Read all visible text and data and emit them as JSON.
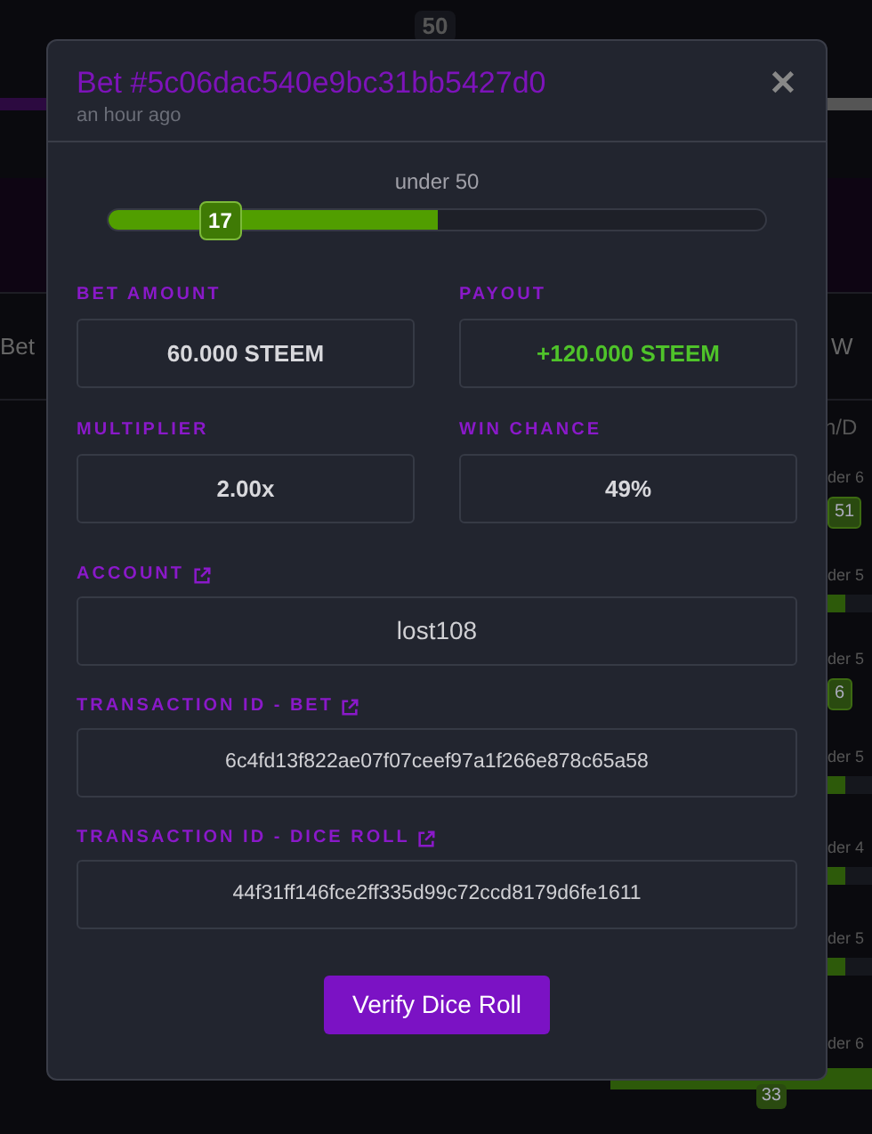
{
  "backdrop": {
    "top_value": "50",
    "left_heading": "Bet",
    "right_heading": "W",
    "right_column_heading": "n/D",
    "rows": [
      {
        "label": "der 6",
        "kind": "badge",
        "value": "51"
      },
      {
        "label": "der 5",
        "kind": "bar"
      },
      {
        "label": "der 5",
        "kind": "badge",
        "value": "6"
      },
      {
        "label": "der 5",
        "kind": "bar"
      },
      {
        "label": "der 4",
        "kind": "bar"
      },
      {
        "label": "der 5",
        "kind": "bar"
      },
      {
        "label": "der 6",
        "kind": "wide",
        "value": "33"
      }
    ]
  },
  "modal": {
    "title": "Bet #5c06dac540e9bc31bb5427d0",
    "subtitle": "an hour ago",
    "close": "✕",
    "roll": {
      "label": "under 50",
      "target": {
        "level": 0.5
      },
      "result": {
        "value": "17",
        "level": 0.17
      }
    },
    "pairs": [
      {
        "label": "BET AMOUNT",
        "value": "60.000 STEEM",
        "kind": "plain"
      },
      {
        "label": "PAYOUT",
        "value": "+120.000 STEEM",
        "kind": "gain"
      },
      {
        "label": "MULTIPLIER",
        "value": "2.00x",
        "kind": "plain"
      },
      {
        "label": "WIN CHANCE",
        "value": "49%",
        "kind": "plain"
      }
    ],
    "links": [
      {
        "label": "ACCOUNT",
        "value": "lost108",
        "kind": "name"
      },
      {
        "label": "TRANSACTION ID - BET",
        "value": "6c4fd13f822ae07f07ceef97a1f266e878c65a58",
        "kind": "hash"
      },
      {
        "label": "TRANSACTION ID - DICE ROLL",
        "value": "44f31ff146fce2ff335d99c72ccd8179d6fe1611",
        "kind": "hash"
      }
    ],
    "button": "Verify Dice Roll"
  }
}
